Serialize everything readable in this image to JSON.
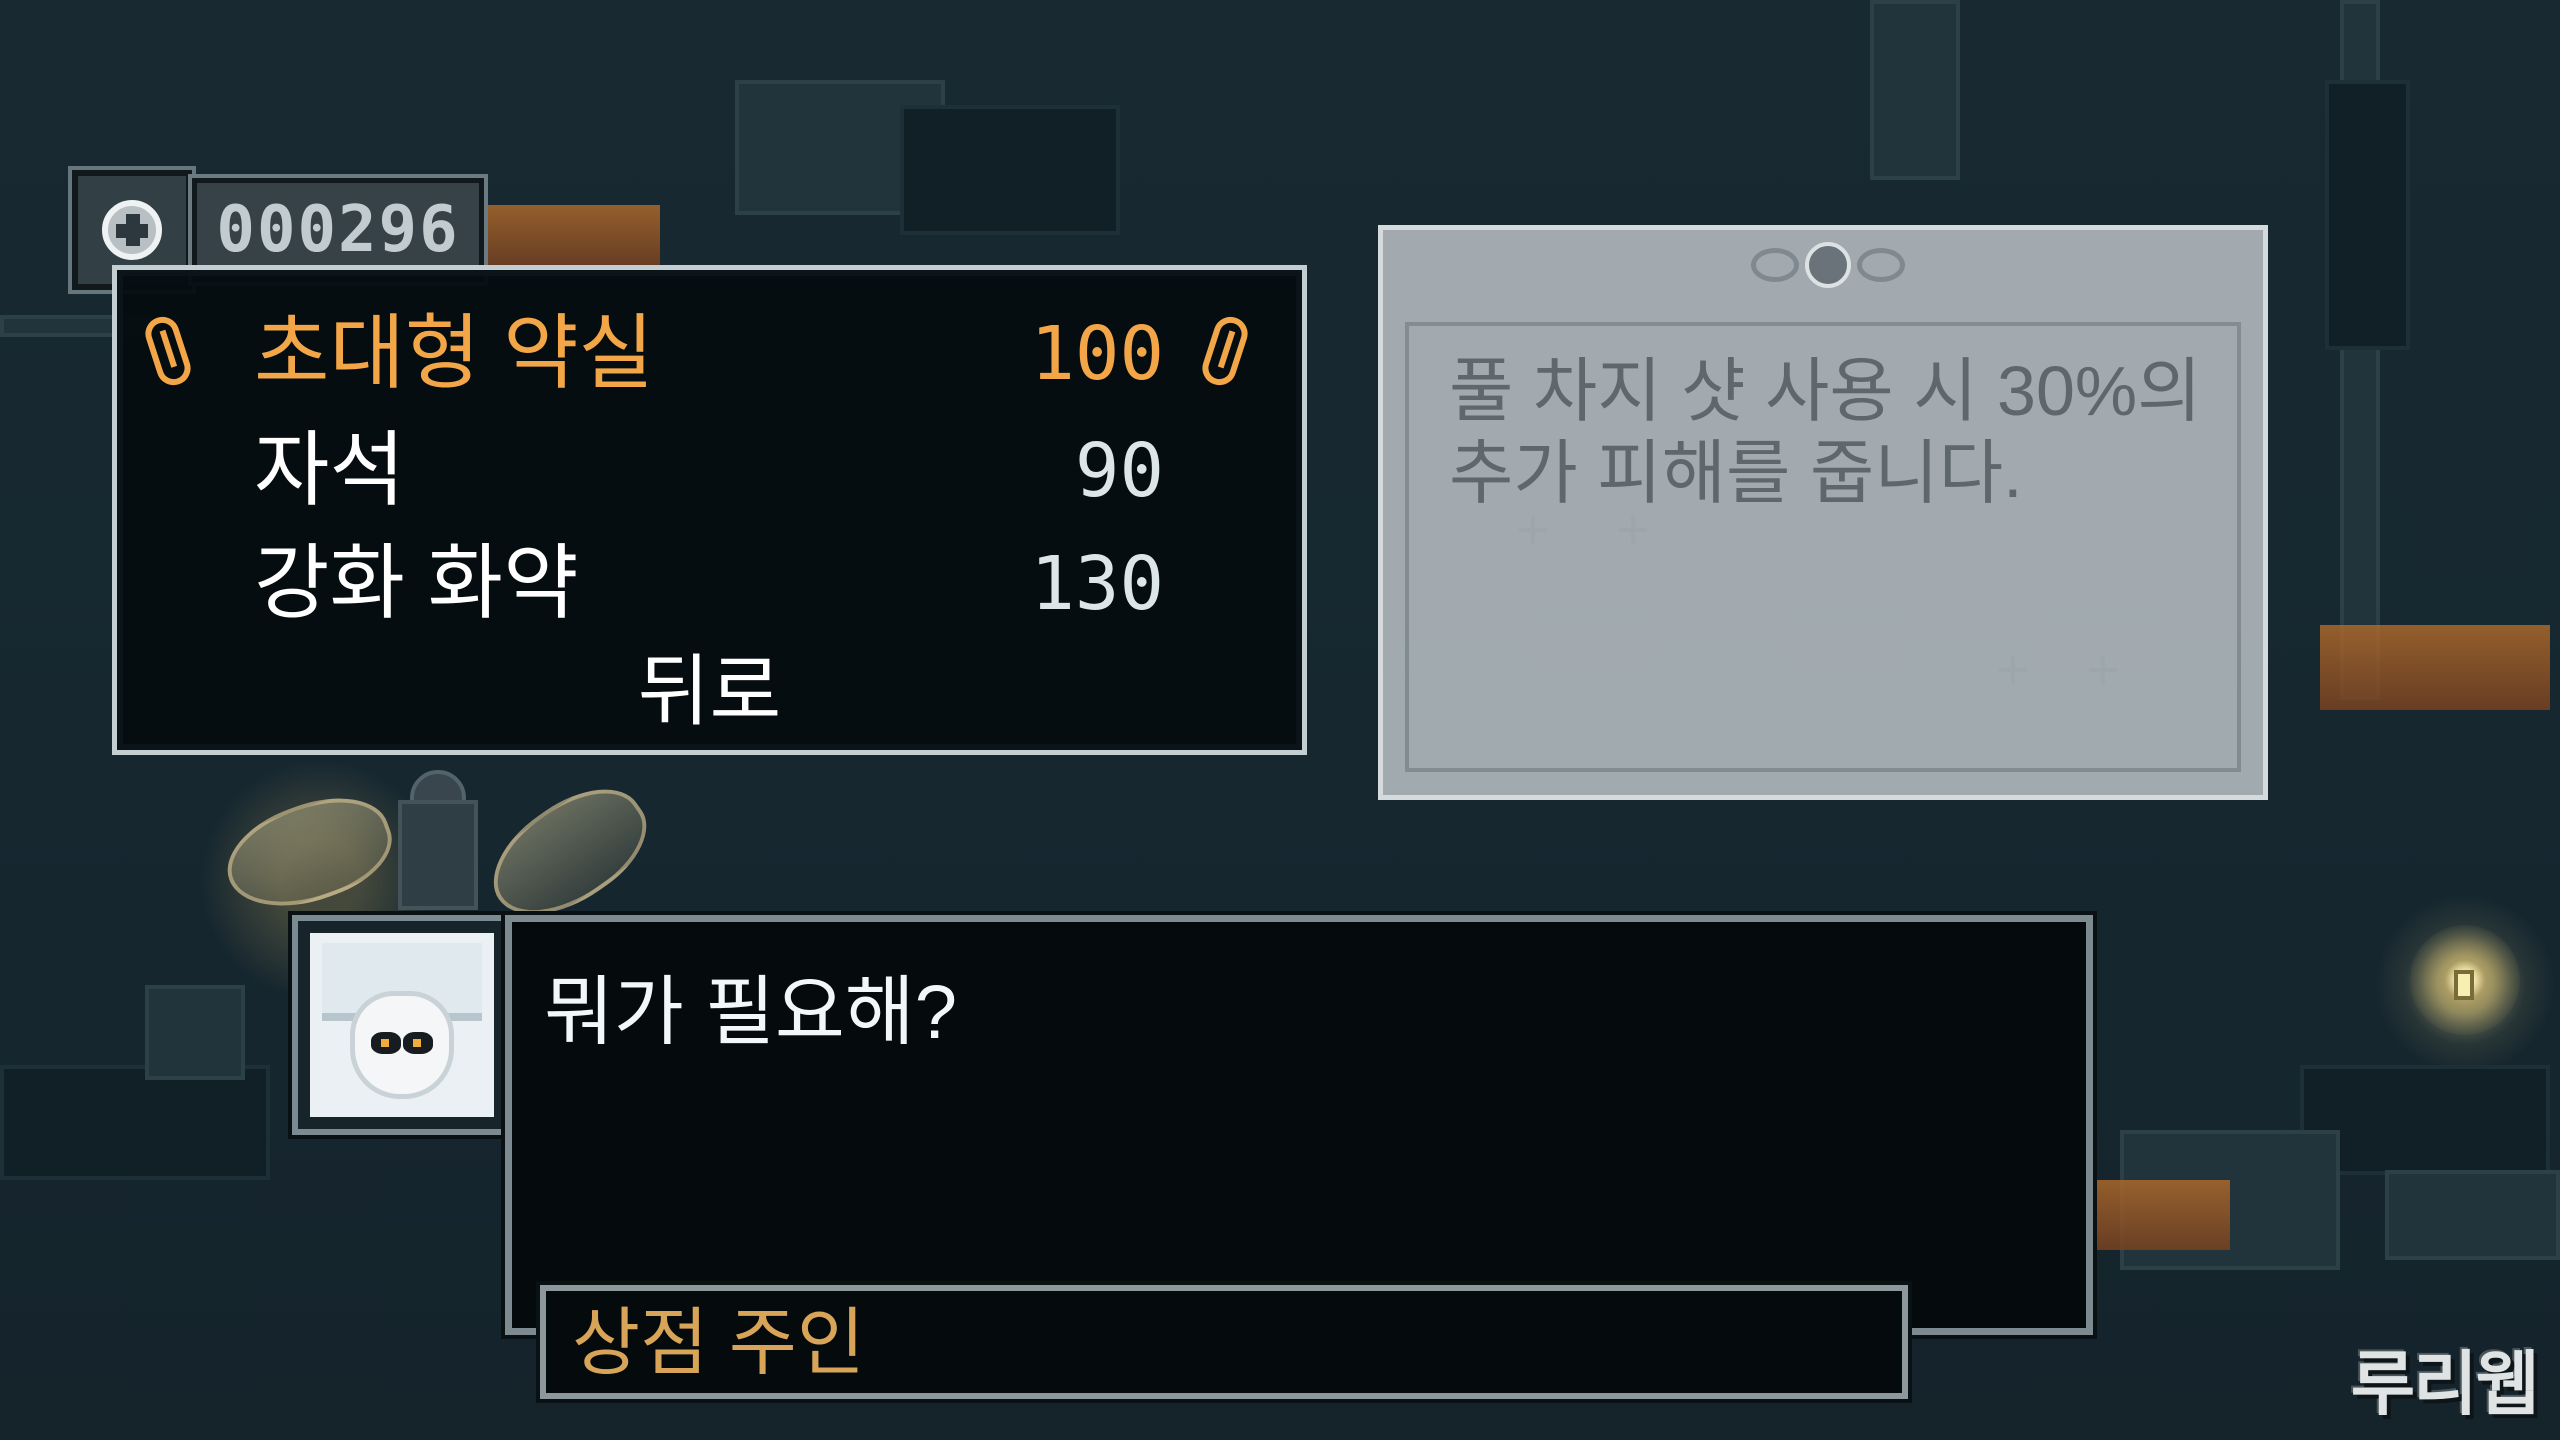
{
  "hud": {
    "currency_value": "000296"
  },
  "shop_menu": {
    "items": [
      {
        "name": "초대형 약실",
        "price": "100",
        "selected": true
      },
      {
        "name": "자석",
        "price": "90",
        "selected": false
      },
      {
        "name": "강화 화약",
        "price": "130",
        "selected": false
      }
    ],
    "back_label": "뒤로"
  },
  "description": {
    "text": "풀 차지 샷 사용 시 30%의 추가 피해를 줍니다."
  },
  "dialog": {
    "text": "뭐가 필요해?",
    "speaker": "상점 주인"
  },
  "watermark": {
    "text": "루리웹"
  },
  "colors": {
    "selected": "#f3a647",
    "menu_text": "#ffffff",
    "speaker": "#d8a458"
  },
  "icons": {
    "currency": "coin-icon",
    "selection": "leaf-icon",
    "ornament": "wing-ornament-icon"
  }
}
